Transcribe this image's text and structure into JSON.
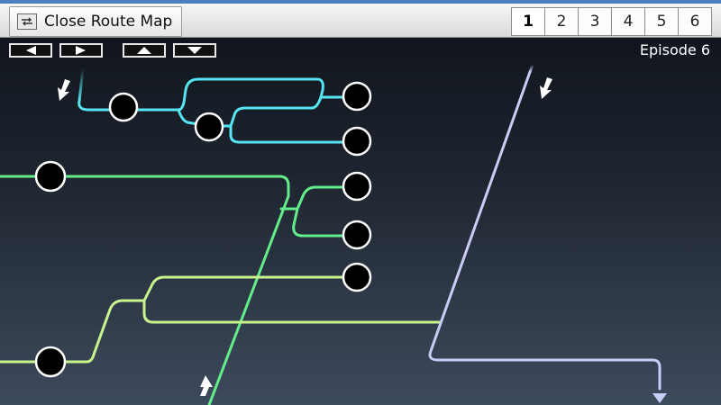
{
  "toolbar": {
    "close_label": "Close Route Map",
    "close_icon": "route-map-icon"
  },
  "episode_tabs": [
    "1",
    "2",
    "3",
    "4",
    "5",
    "6"
  ],
  "active_episode_tab": "1",
  "nav_buttons": [
    {
      "name": "scroll-left-button",
      "icon": "triangle-left-icon"
    },
    {
      "name": "scroll-right-button",
      "icon": "triangle-right-icon"
    },
    {
      "name": "scroll-up-button",
      "icon": "triangle-up-icon"
    },
    {
      "name": "scroll-down-button",
      "icon": "triangle-down-icon"
    }
  ],
  "episode_label": "Episode 6",
  "route_colors": {
    "cyan": "#55e6f2",
    "green": "#62ec8a",
    "lime": "#c9f38c",
    "lavender": "#c9cdf6"
  }
}
